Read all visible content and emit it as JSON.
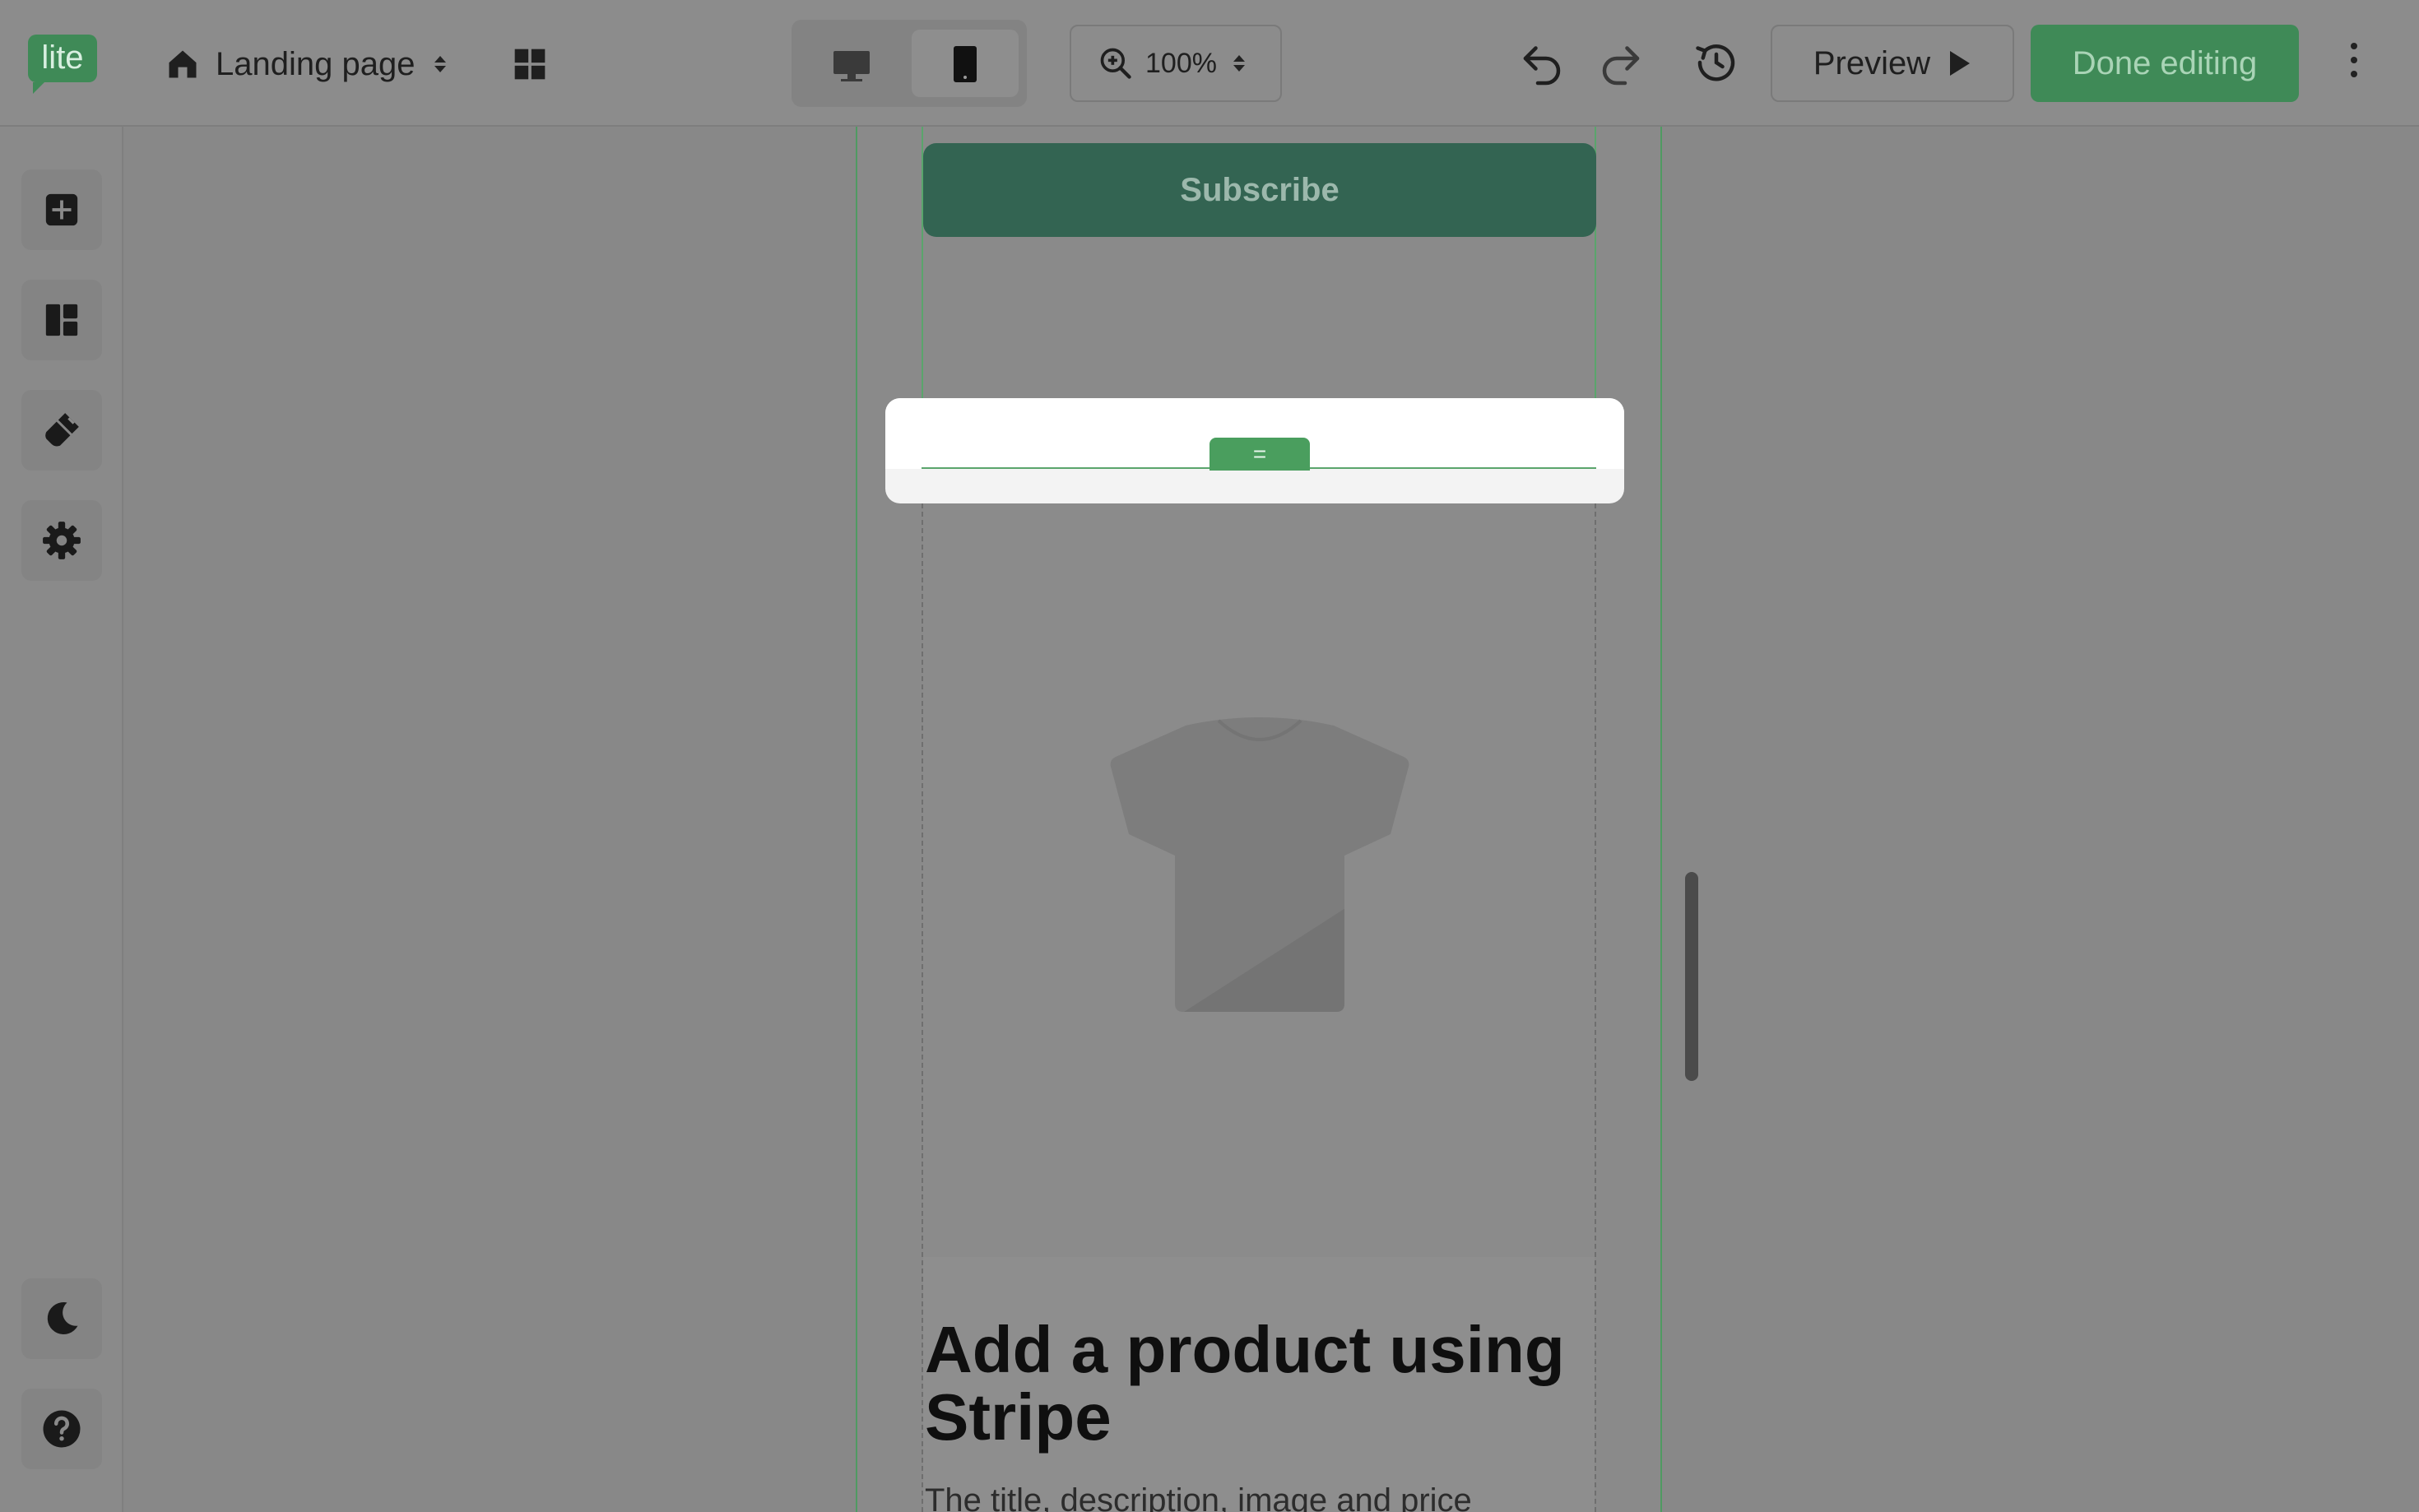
{
  "app": {
    "logo_text": "lite",
    "brand_color": "#3f8a57"
  },
  "topbar": {
    "page_select": {
      "label": "Landing page",
      "icon": "home-icon"
    },
    "pages_icon": "grid-icon",
    "device_toggle": {
      "selected": "mobile",
      "options": [
        "desktop-icon",
        "mobile-icon"
      ]
    },
    "zoom": {
      "value": "100%",
      "icon": "zoom-in-icon"
    },
    "undo_icon": "undo-icon",
    "redo_icon": "redo-icon",
    "history_icon": "history-icon",
    "preview_label": "Preview",
    "done_label": "Done editing",
    "more_icon": "kebab-icon"
  },
  "sidebar": {
    "items": [
      {
        "name": "add",
        "icon": "plus-square-icon"
      },
      {
        "name": "layout",
        "icon": "layout-icon"
      },
      {
        "name": "styles",
        "icon": "paint-brush-icon"
      },
      {
        "name": "settings",
        "icon": "gear-icon"
      }
    ],
    "bottom_items": [
      {
        "name": "dark-mode",
        "icon": "moon-icon"
      },
      {
        "name": "help",
        "icon": "help-icon"
      }
    ]
  },
  "canvas": {
    "subscribe_label": "Subscribe",
    "drag_handle_glyph": "=",
    "product": {
      "title": "Add a product using Stripe",
      "description": "The title, description, image and price"
    }
  }
}
